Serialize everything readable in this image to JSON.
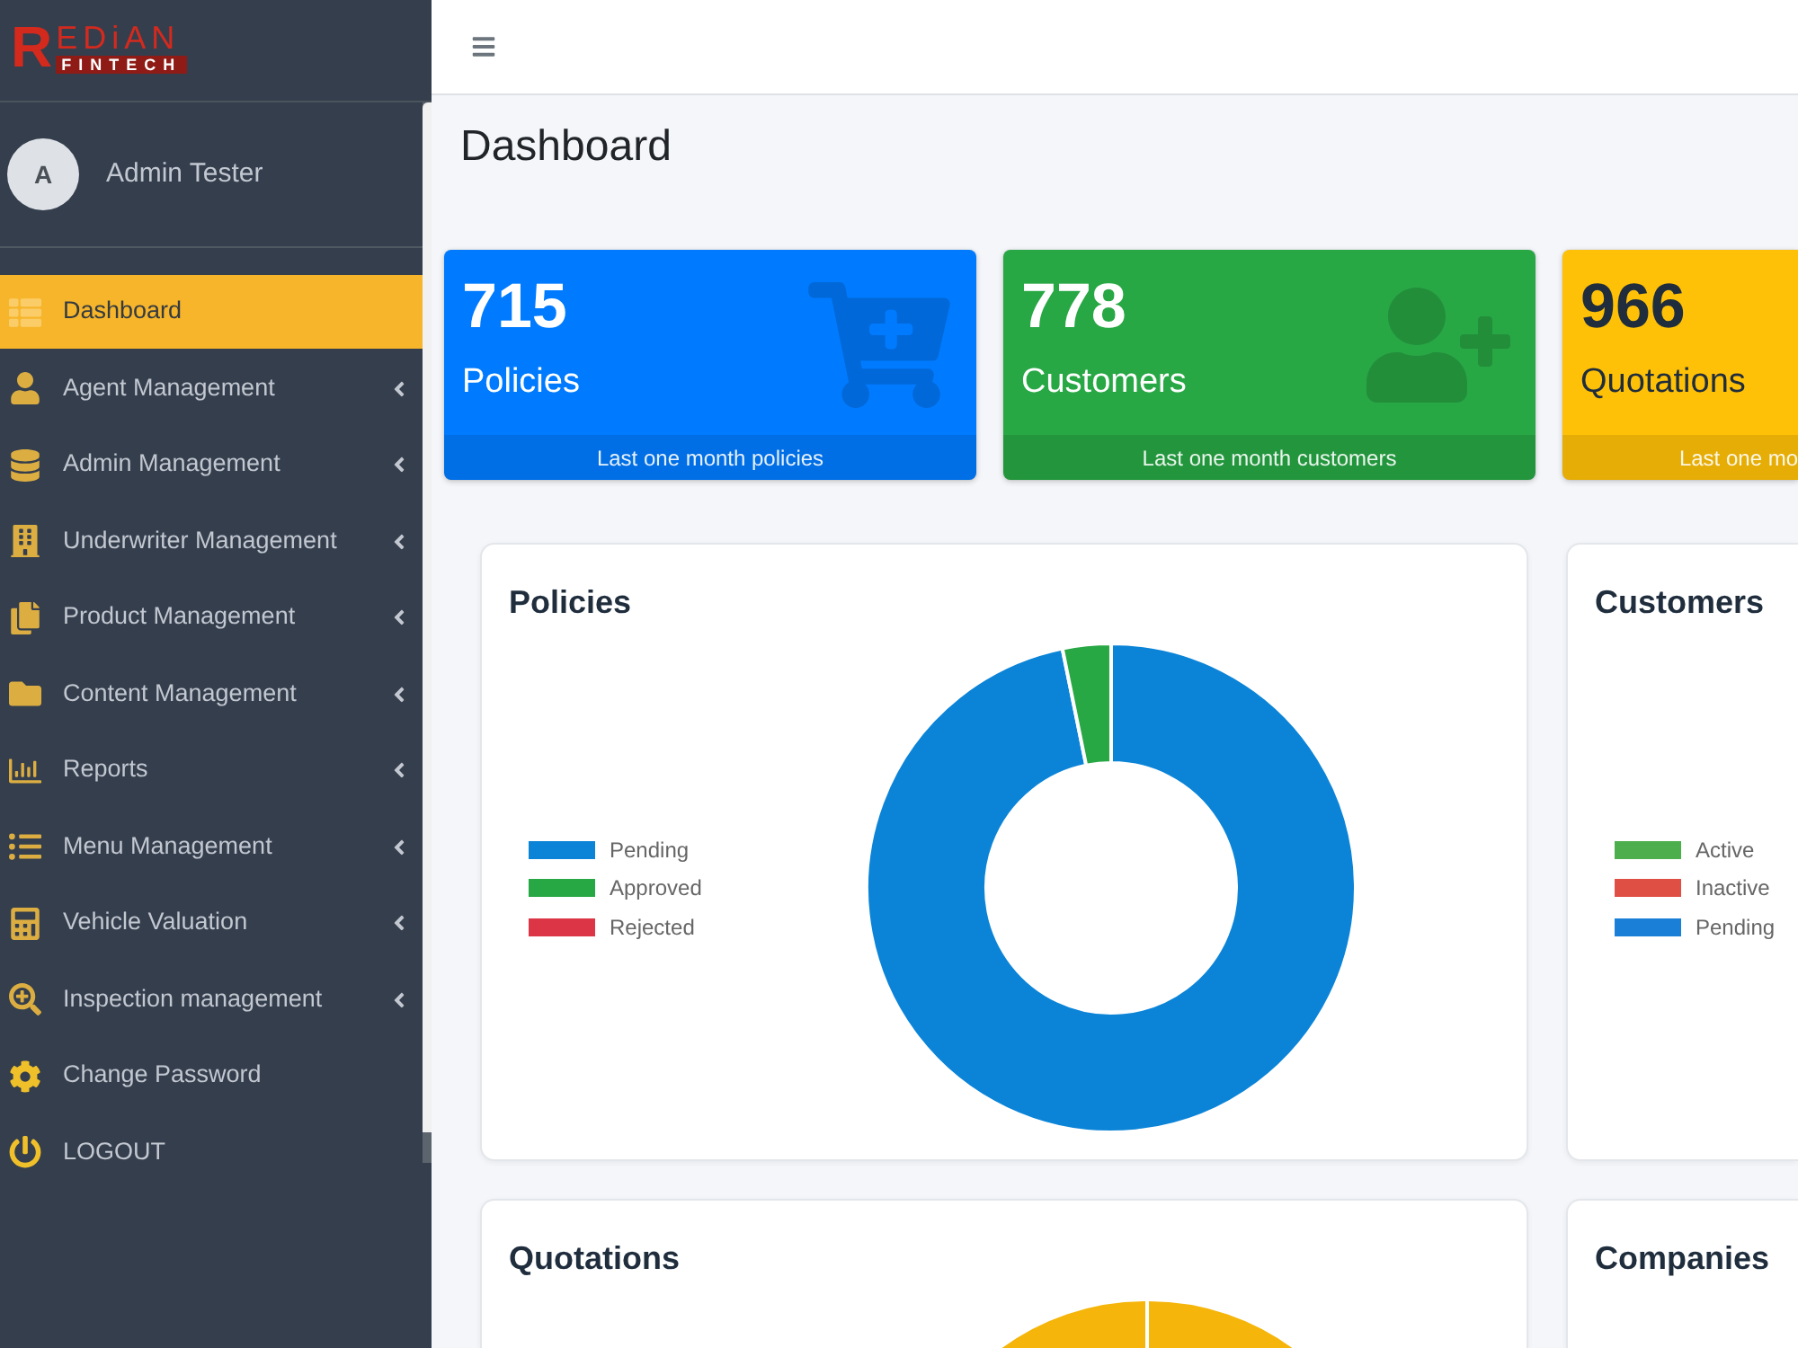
{
  "logo": {
    "mark": "R",
    "name": "EDiAN",
    "tagline": "FINTECH"
  },
  "user": {
    "initial": "A",
    "name": "Admin Tester"
  },
  "sidebar": {
    "items": [
      {
        "label": "Dashboard",
        "selected": true,
        "has_submenu": false
      },
      {
        "label": "Agent Management",
        "selected": false,
        "has_submenu": true
      },
      {
        "label": "Admin Management",
        "selected": false,
        "has_submenu": true
      },
      {
        "label": "Underwriter Management",
        "selected": false,
        "has_submenu": true
      },
      {
        "label": "Product Management",
        "selected": false,
        "has_submenu": true
      },
      {
        "label": "Content Management",
        "selected": false,
        "has_submenu": true
      },
      {
        "label": "Reports",
        "selected": false,
        "has_submenu": true
      },
      {
        "label": "Menu Management",
        "selected": false,
        "has_submenu": true
      },
      {
        "label": "Vehicle Valuation",
        "selected": false,
        "has_submenu": true
      },
      {
        "label": "Inspection management",
        "selected": false,
        "has_submenu": true
      },
      {
        "label": "Change Password",
        "selected": false,
        "has_submenu": false
      },
      {
        "label": "LOGOUT",
        "selected": false,
        "has_submenu": false
      }
    ]
  },
  "page_title": "Dashboard",
  "stat_cards": [
    {
      "value": "715",
      "label": "Policies",
      "footer": "Last one month policies",
      "color": "#007bff"
    },
    {
      "value": "778",
      "label": "Customers",
      "footer": "Last one month customers",
      "color": "#28a745"
    },
    {
      "value": "966",
      "label": "Quotations",
      "footer": "Last one mo",
      "color": "#ffc107"
    }
  ],
  "charts": [
    {
      "title": "Policies",
      "legend": [
        {
          "label": "Pending",
          "color": "#0b84d8"
        },
        {
          "label": "Approved",
          "color": "#28a745"
        },
        {
          "label": "Rejected",
          "color": "#dc3545"
        }
      ]
    },
    {
      "title": "Customers",
      "legend": [
        {
          "label": "Active",
          "color": "#4cae4c"
        },
        {
          "label": "Inactive",
          "color": "#e04f43"
        },
        {
          "label": "Pending",
          "color": "#1a7fd6"
        }
      ]
    },
    {
      "title": "Quotations"
    },
    {
      "title": "Companies"
    }
  ]
}
